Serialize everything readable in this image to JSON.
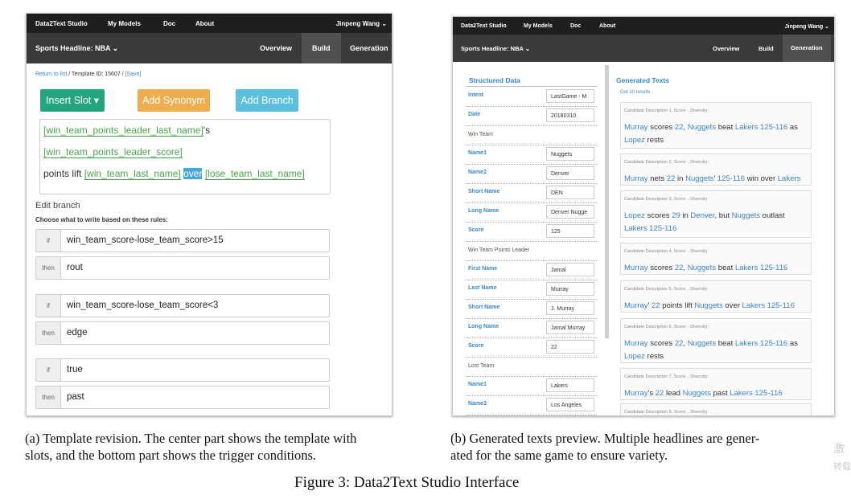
{
  "panel_a": {
    "nav": {
      "brand": "Data2Text Studio",
      "models": "My Models",
      "doc": "Doc",
      "about": "About",
      "user": "Jinpeng Wang ⌄"
    },
    "sub": {
      "template": "Sports Headline: NBA ⌄",
      "tabs": [
        "Overview",
        "Build",
        "Generation"
      ]
    },
    "breadcrumb": {
      "return": "Return to list",
      "template_id": " / Template ID: 15607 / ",
      "save": "[Save]"
    },
    "buttons": {
      "insert_slot": "Insert Slot ▾",
      "add_synonym": "Add Synonym",
      "add_branch": "Add Branch"
    },
    "editor": {
      "slot1": "[win_team_points_leader_last_name]",
      "t1": "'s ",
      "slot2": "[win_team_points_leader_score]",
      "t2": "points lift ",
      "slot3": "[win_team_last_name]",
      "t3": " ",
      "selected": "over",
      "t4": " ",
      "slot4": "[lose_team_last_name]"
    },
    "edit_branch": {
      "title": "Edit branch",
      "subtitle": "Choose what to write based on these rules:"
    },
    "rules": [
      {
        "tag": "if",
        "text": "win_team_score-lose_team_score>15"
      },
      {
        "tag": "then",
        "text": "rout"
      },
      {
        "tag": "if",
        "text": "win_team_score-lose_team_score<3"
      },
      {
        "tag": "then",
        "text": "edge"
      },
      {
        "tag": "if",
        "text": "true"
      },
      {
        "tag": "then",
        "text": "past"
      }
    ]
  },
  "panel_b": {
    "nav": {
      "brand": "Data2Text Studio",
      "models": "My Models",
      "doc": "Doc",
      "about": "About",
      "user": "Jinpeng Wang ⌄"
    },
    "sub": {
      "template": "Sports Headline: NBA ⌄",
      "tabs": [
        "Overview",
        "Build",
        "Generation"
      ]
    },
    "structured_data_title": "Structured Data",
    "rows": [
      {
        "kind": "kv",
        "key": "Intent",
        "value": "LastGame - M"
      },
      {
        "kind": "kv",
        "key": "Date",
        "value": "20180310"
      },
      {
        "kind": "header",
        "key": "Win Team"
      },
      {
        "kind": "kv",
        "key": "Name1",
        "value": "Nuggets"
      },
      {
        "kind": "kv",
        "key": "Name2",
        "value": "Denver"
      },
      {
        "kind": "kv",
        "key": "Short Name",
        "value": "DEN"
      },
      {
        "kind": "kv",
        "key": "Long Name",
        "value": "Denver Nugge"
      },
      {
        "kind": "kv",
        "key": "Score",
        "value": "125"
      },
      {
        "kind": "header",
        "key": "Win Team Points Leader"
      },
      {
        "kind": "kv",
        "key": "First Name",
        "value": "Jamal"
      },
      {
        "kind": "kv",
        "key": "Last Name",
        "value": "Murray"
      },
      {
        "kind": "kv",
        "key": "Short Name",
        "value": "J. Murray"
      },
      {
        "kind": "kv",
        "key": "Long Name",
        "value": "Jamal Murray"
      },
      {
        "kind": "kv",
        "key": "Score",
        "value": "22"
      },
      {
        "kind": "header",
        "key": "Lost Team"
      },
      {
        "kind": "kv",
        "key": "Name1",
        "value": "Lakers"
      },
      {
        "kind": "kv",
        "key": "Name2",
        "value": "Los Angeles"
      }
    ],
    "generated_title": "Generated Texts",
    "results": "Got 10 results.",
    "cards": [
      {
        "head": "Candidate Description 1, Score: , Diversity:",
        "parts": [
          [
            "Murray",
            1
          ],
          [
            " scores ",
            0
          ],
          [
            "22",
            1
          ],
          [
            ", ",
            0
          ],
          [
            "Nuggets",
            1
          ],
          [
            " beat ",
            0
          ],
          [
            "Lakers",
            1
          ],
          [
            " ",
            0
          ],
          [
            "125-116",
            1
          ],
          [
            " as ",
            0
          ],
          [
            "Lopez",
            1
          ],
          [
            " rests",
            0
          ]
        ]
      },
      {
        "head": "Candidate Description 2, Score: , Diversity:",
        "parts": [
          [
            "Murray",
            1
          ],
          [
            " nets ",
            0
          ],
          [
            "22",
            1
          ],
          [
            " in ",
            0
          ],
          [
            "Nuggets",
            1
          ],
          [
            "' ",
            0
          ],
          [
            "125-116",
            1
          ],
          [
            " win over ",
            0
          ],
          [
            "Lakers",
            1
          ]
        ]
      },
      {
        "head": "Candidate Description 3, Score: , Diversity:",
        "parts": [
          [
            "Lopez",
            1
          ],
          [
            " scores ",
            0
          ],
          [
            "29",
            1
          ],
          [
            " in ",
            0
          ],
          [
            "Denver",
            1
          ],
          [
            ", but ",
            0
          ],
          [
            "Nuggets",
            1
          ],
          [
            " outlast ",
            0
          ],
          [
            "Lakers",
            1
          ],
          [
            " ",
            0
          ],
          [
            "125-116",
            1
          ]
        ]
      },
      {
        "head": "Candidate Description 4, Score: , Diversity:",
        "parts": [
          [
            "Murray",
            1
          ],
          [
            " scores ",
            0
          ],
          [
            "22",
            1
          ],
          [
            ", ",
            0
          ],
          [
            "Nuggets",
            1
          ],
          [
            " beat ",
            0
          ],
          [
            "Lakers",
            1
          ],
          [
            " ",
            0
          ],
          [
            "125-116",
            1
          ]
        ]
      },
      {
        "head": "Candidate Description 5, Score: , Diversity:",
        "parts": [
          [
            "Murray",
            1
          ],
          [
            "' ",
            0
          ],
          [
            "22",
            1
          ],
          [
            " points lift ",
            0
          ],
          [
            "Nuggets",
            1
          ],
          [
            " over ",
            0
          ],
          [
            "Lakers",
            1
          ],
          [
            " ",
            0
          ],
          [
            "125-116",
            1
          ]
        ]
      },
      {
        "head": "Candidate Description 6, Score: , Diversity:",
        "parts": [
          [
            "Murray",
            1
          ],
          [
            " scores ",
            0
          ],
          [
            "22",
            1
          ],
          [
            ", ",
            0
          ],
          [
            "Nuggets",
            1
          ],
          [
            " beat ",
            0
          ],
          [
            "Lakers",
            1
          ],
          [
            " ",
            0
          ],
          [
            "125-116",
            1
          ],
          [
            " as ",
            0
          ],
          [
            "Lopez",
            1
          ],
          [
            " rests",
            0
          ]
        ]
      },
      {
        "head": "Candidate Description 7, Score: , Diversity:",
        "parts": [
          [
            "Murray",
            1
          ],
          [
            "'s ",
            0
          ],
          [
            "22",
            1
          ],
          [
            " lead ",
            0
          ],
          [
            "Nuggets",
            1
          ],
          [
            " past ",
            0
          ],
          [
            "Lakers",
            1
          ],
          [
            " ",
            0
          ],
          [
            "125-116",
            1
          ]
        ]
      },
      {
        "head": "Candidate Description 8, Score: , Diversity:",
        "parts": []
      }
    ]
  },
  "captions": {
    "a1": "(a) Template revision. The center part shows the template with",
    "a2": "slots, and the bottom part shows the trigger conditions.",
    "b1": "(b) Generated texts preview. Multiple headlines are gener-",
    "b2": "ated for the same game to ensure variety.",
    "figure": "Figure 3: Data2Text Studio Interface",
    "wm1": "激",
    "wm2": "转载"
  }
}
